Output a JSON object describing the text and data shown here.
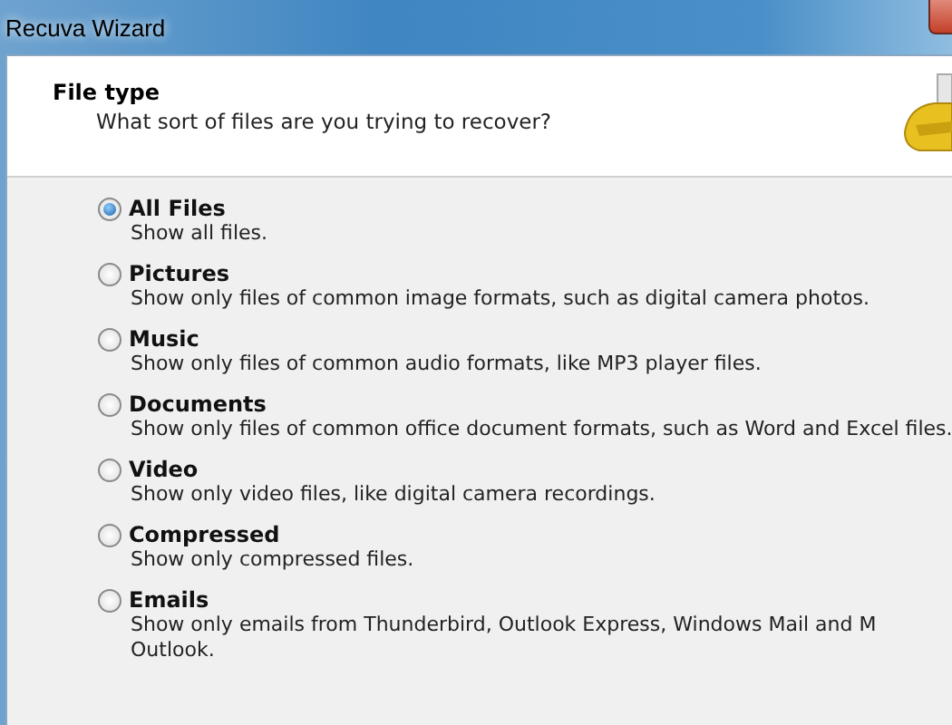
{
  "window": {
    "title": "Recuva Wizard"
  },
  "header": {
    "title": "File type",
    "subtitle": "What sort of files are you trying to recover?"
  },
  "options": [
    {
      "label": "All Files",
      "selected": true,
      "description": [
        "Show all files."
      ]
    },
    {
      "label": "Pictures",
      "selected": false,
      "description": [
        "Show only files of common image formats, such as digital camera photos."
      ]
    },
    {
      "label": "Music",
      "selected": false,
      "description": [
        "Show only files of common audio formats, like MP3 player files."
      ]
    },
    {
      "label": "Documents",
      "selected": false,
      "description": [
        "Show only files of common office document formats, such as Word and Excel files."
      ]
    },
    {
      "label": "Video",
      "selected": false,
      "description": [
        "Show only video files, like digital camera recordings."
      ]
    },
    {
      "label": "Compressed",
      "selected": false,
      "description": [
        "Show only compressed files."
      ]
    },
    {
      "label": "Emails",
      "selected": false,
      "description": [
        "Show only emails from Thunderbird, Outlook Express, Windows Mail and M",
        "Outlook."
      ]
    }
  ]
}
